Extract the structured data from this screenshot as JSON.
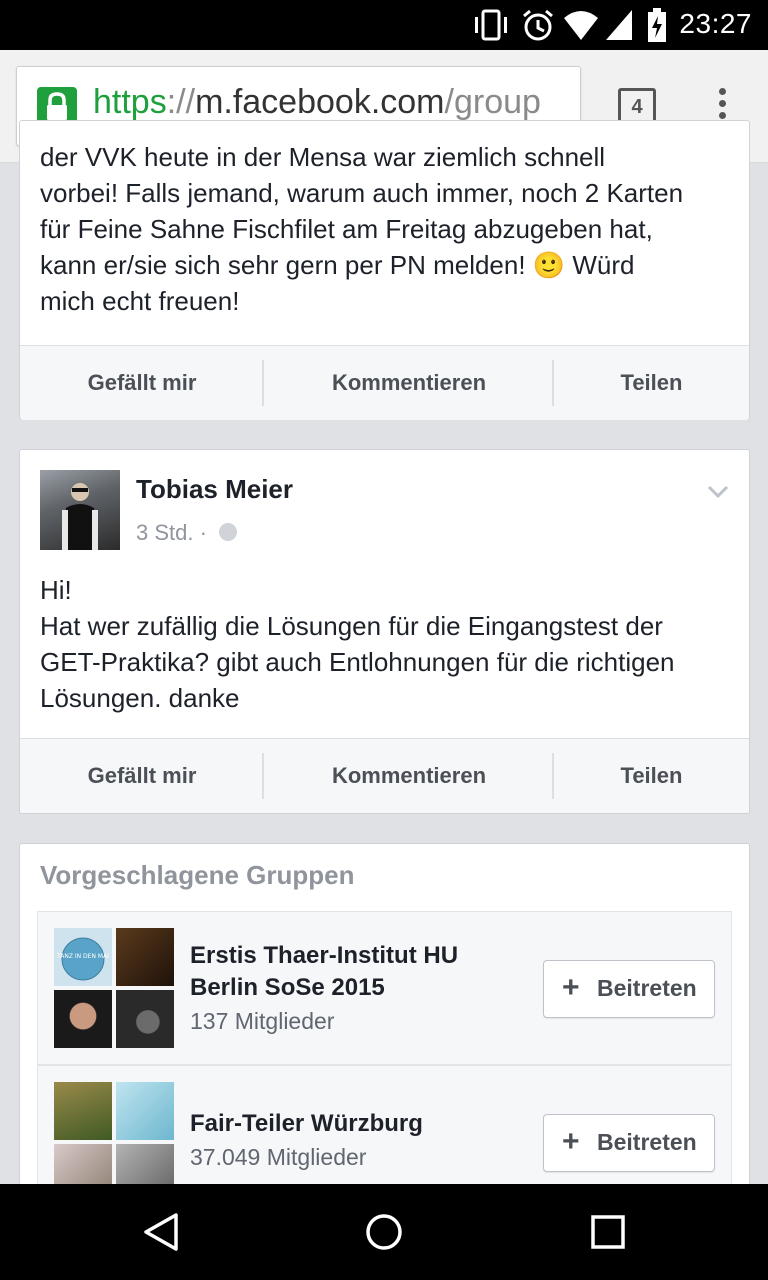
{
  "status_bar": {
    "time": "23:27"
  },
  "browser": {
    "url_scheme": "https",
    "url_separator": "://",
    "url_host": "m.facebook.com",
    "url_path": "/group",
    "tab_count": "4"
  },
  "post1": {
    "text_cut_top": "der VVK heute in der Mensa war ziemlich schnell",
    "lines": [
      "vorbei! Falls jemand, warum auch immer, noch 2 Karten",
      "für Feine Sahne Fischfilet am Freitag abzugeben hat,",
      "kann er/sie sich sehr gern per PN melden! 🙂 Würd",
      "mich echt freuen!"
    ]
  },
  "post2": {
    "author": "Tobias Meier",
    "time": "3 Std.",
    "dot": "·",
    "lines": [
      "Hi!",
      "Hat wer zufällig die Lösungen für die Eingangstest der",
      "GET-Praktika? gibt auch Entlohnungen für die richtigen",
      "Lösungen. danke"
    ]
  },
  "actions": {
    "like": "Gefällt mir",
    "comment": "Kommentieren",
    "share": "Teilen"
  },
  "suggested": {
    "title": "Vorgeschlagene Gruppen",
    "join_label": "Beitreten",
    "join_plus": "+",
    "groups": [
      {
        "name_line1": "Erstis Thaer-Institut HU",
        "name_line2": "Berlin SoSe 2015",
        "members": "137 Mitglieder",
        "thumb_text": "TANZ IN DEN MAI"
      },
      {
        "name_line1": "Fair-Teiler Würzburg",
        "members": "37.049 Mitglieder"
      }
    ]
  },
  "icons": [
    "vibrate-icon",
    "alarm-icon",
    "wifi-icon",
    "signal-icon",
    "battery-icon",
    "lock-icon",
    "tabs-icon",
    "menu-icon",
    "globe-icon",
    "chevron-down-icon",
    "back-icon",
    "home-icon",
    "recents-icon"
  ]
}
